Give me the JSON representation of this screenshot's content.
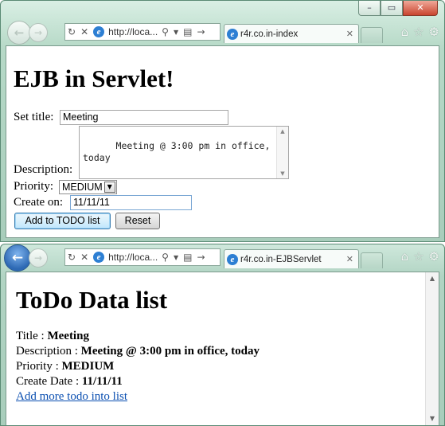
{
  "windows": [
    {
      "address": "http://loca...",
      "tab_title": "r4r.co.in-index",
      "page": {
        "heading": "EJB in Servlet!",
        "title_label": "Set title:",
        "title_value": "Meeting",
        "description_label": "Description:",
        "description_value": "Meeting @ 3:00 pm in office,\ntoday",
        "priority_label": "Priority:",
        "priority_value": "MEDIUM",
        "create_label": "Create on:",
        "create_value": "11/11/11",
        "add_button": "Add to TODO list",
        "reset_button": "Reset"
      }
    },
    {
      "address": "http://loca...",
      "tab_title": "r4r.co.in-EJBServlet",
      "page": {
        "heading": "ToDo Data list",
        "title_label": "Title : ",
        "title_value": "Meeting",
        "description_label": "Description : ",
        "description_value": "Meeting @ 3:00 pm in office, today",
        "priority_label": "Priority : ",
        "priority_value": "MEDIUM",
        "date_label": "Create Date : ",
        "date_value": "11/11/11",
        "link_text": "Add more todo into list"
      }
    }
  ],
  "window_controls": {
    "minimize": "–",
    "maximize": "▭",
    "close": "✕"
  },
  "icons": {
    "back": "back-arrow-icon",
    "forward": "forward-arrow-icon",
    "refresh": "refresh-icon",
    "stop": "stop-icon",
    "ie": "ie-icon",
    "search": "search-icon",
    "compat": "compat-icon",
    "go": "go-icon",
    "tab_close": "close-icon",
    "home": "home-icon",
    "favorites": "star-icon",
    "settings": "gear-icon"
  },
  "colors": {
    "frame": "#b6d9c7",
    "link": "#0b4fb1",
    "close": "#c9452f",
    "back_active": "#2d69b4"
  }
}
